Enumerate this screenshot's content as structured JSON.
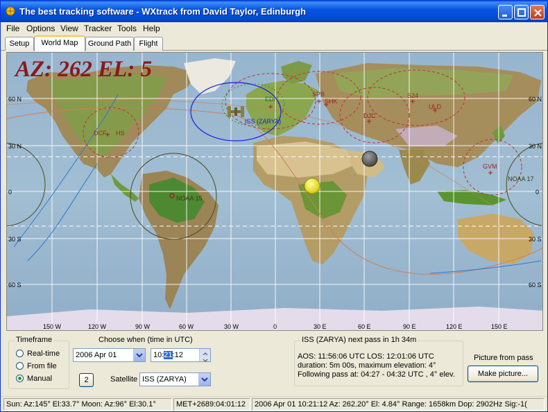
{
  "window": {
    "title": "The best tracking software - WXtrack from David Taylor, Edinburgh"
  },
  "menu": [
    "File",
    "Options",
    "View",
    "Tracker",
    "Tools",
    "Help"
  ],
  "tabs": [
    "Setup",
    "World Map",
    "Ground Path",
    "Flight"
  ],
  "active_tab": "World Map",
  "map": {
    "az_el_text": "AZ: 262   EL: 5",
    "lat_labels": [
      "60 N",
      "30 N",
      "0",
      "30 S",
      "60 S"
    ],
    "lon_labels": [
      "150 W",
      "120 W",
      "90 W",
      "60 W",
      "30 W",
      "0",
      "30 E",
      "60 E",
      "90 E",
      "120 E",
      "150 E"
    ],
    "stations": [
      "EDI",
      "SPB",
      "SHK",
      "S24",
      "ULD",
      "DJC",
      "DCF",
      "HS",
      "GVM"
    ],
    "satellites": [
      "ISS (ZARYA)",
      "NOAA 15",
      "NOAA 17"
    ],
    "colors": {
      "iss_footprint": "#1a1ae0",
      "noaa_footprint": "#4a4a1a",
      "station_circle": "#c03030",
      "iss_track": "#d08050",
      "other_track": "#2a7ad0",
      "sun": "#ffff00",
      "moon": "#606060"
    }
  },
  "timeframe": {
    "title": "Timeframe",
    "options": [
      "Real-time",
      "From file",
      "Manual"
    ],
    "selected": "Manual"
  },
  "choose": {
    "title": "Choose when (time in UTC)",
    "date": "2006 Apr  01",
    "time_pre": "10:",
    "time_sel": "21",
    "time_post": ":12",
    "step_button": "2",
    "satellite_label": "Satellite",
    "satellite": "ISS (ZARYA)"
  },
  "pass": {
    "title": "ISS (ZARYA) next pass in 1h 34m",
    "line1": "AOS: 11:56:06 UTC  LOS: 12:01:06 UTC",
    "line2": "duration: 5m 00s,  maximum elevation: 4°",
    "line3": "Following pass at: 04:27 - 04:32 UTC , 4° elev."
  },
  "picture": {
    "label": "Picture from pass",
    "button": "Make picture..."
  },
  "status": {
    "sun_moon": "Sun: Az:145° El:33.7°  Moon: Az:96° El:30.1°",
    "met": "MET+2689:04:01:12",
    "info": "2006 Apr 01  10:21:12  Az: 262.20°  El: 4.84°  Range: 1658km  Dop: 2902Hz  Sig:-1("
  }
}
